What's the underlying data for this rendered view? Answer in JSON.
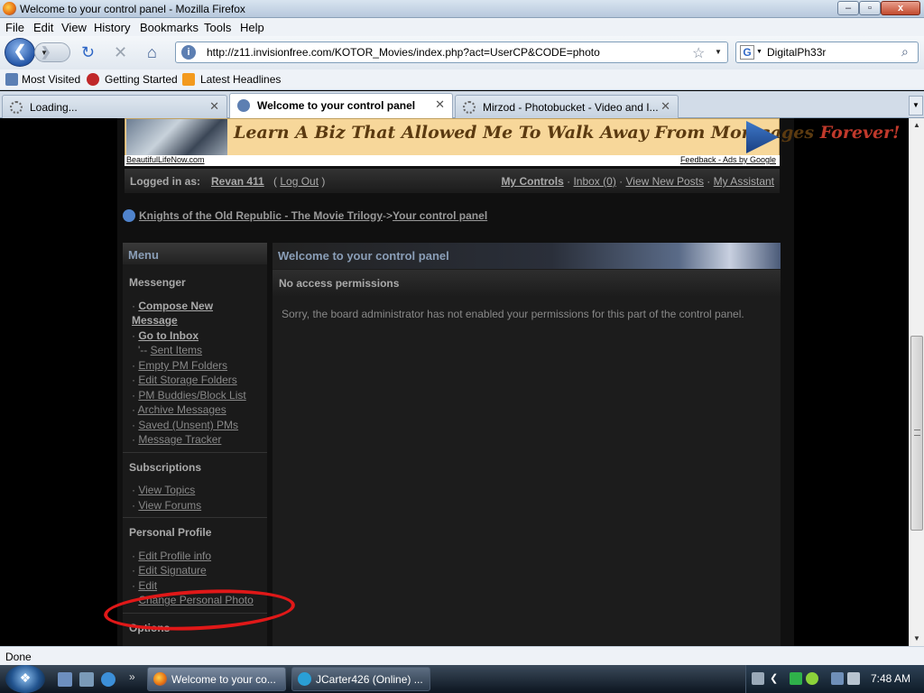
{
  "window": {
    "title": "Welcome to your control panel - Mozilla Firefox",
    "btn_min": "–",
    "btn_max": "▫",
    "btn_close": "x"
  },
  "menubar": [
    "File",
    "Edit",
    "View",
    "History",
    "Bookmarks",
    "Tools",
    "Help"
  ],
  "nav": {
    "url": "http://z11.invisionfree.com/KOTOR_Movies/index.php?act=UserCP&CODE=photo",
    "search_value": "DigitalPh33r"
  },
  "bookmarks": [
    "Most Visited",
    "Getting Started",
    "Latest Headlines"
  ],
  "tabs": [
    {
      "title": "Loading..."
    },
    {
      "title": "Welcome to your control panel"
    },
    {
      "title": "Mirzod - Photobucket - Video and I..."
    }
  ],
  "ad": {
    "headline_a": "Learn A Biz That Allowed Me To ",
    "headline_b": "Walk Away From Mortgages ",
    "headline_c": "Forever!",
    "source": "BeautifulLifeNow.com",
    "feedback": "Feedback - Ads by Google"
  },
  "userbar": {
    "logged_in_label": "Logged in as:",
    "username": "Revan 411",
    "logout": "Log Out",
    "my_controls": "My Controls",
    "inbox": "Inbox (0)",
    "view_new_posts": "View New Posts",
    "my_assistant": "My Assistant"
  },
  "breadcrumb": {
    "forum": "Knights of the Old Republic - The Movie Trilogy",
    "separator": "->",
    "current": "Your control panel"
  },
  "menu": {
    "title": "Menu",
    "messenger": {
      "title": "Messenger",
      "compose_1": "Compose New",
      "compose_2": "Message",
      "go_inbox": "Go to Inbox",
      "sent_prefix": "'-- ",
      "sent": "Sent Items",
      "empty_pm": "Empty PM Folders",
      "edit_storage": "Edit Storage Folders",
      "pm_buddies": "PM Buddies/Block List",
      "archive": "Archive Messages",
      "saved": "Saved (Unsent) PMs",
      "tracker": "Message Tracker"
    },
    "subscriptions": {
      "title": "Subscriptions",
      "view_topics": "View Topics",
      "view_forums": "View Forums"
    },
    "profile": {
      "title": "Personal Profile",
      "edit_profile": "Edit Profile info",
      "edit_signature": "Edit Signature",
      "edit_avatar": "Edit",
      "change_photo": "Change Personal Photo"
    },
    "options": {
      "title": "Options"
    }
  },
  "main": {
    "header": "Welcome to your control panel",
    "subheader": "No access permissions",
    "message": "Sorry, the board administrator has not enabled your permissions for this part of the control panel."
  },
  "status": "Done",
  "taskbar": {
    "more": "»",
    "items": [
      {
        "title": "Welcome to your co..."
      },
      {
        "title": "JCarter426 (Online) ..."
      }
    ],
    "clock": "7:48 AM"
  },
  "colors": {
    "accent": "#4f83cc",
    "annotation_circle": "#e01818"
  }
}
